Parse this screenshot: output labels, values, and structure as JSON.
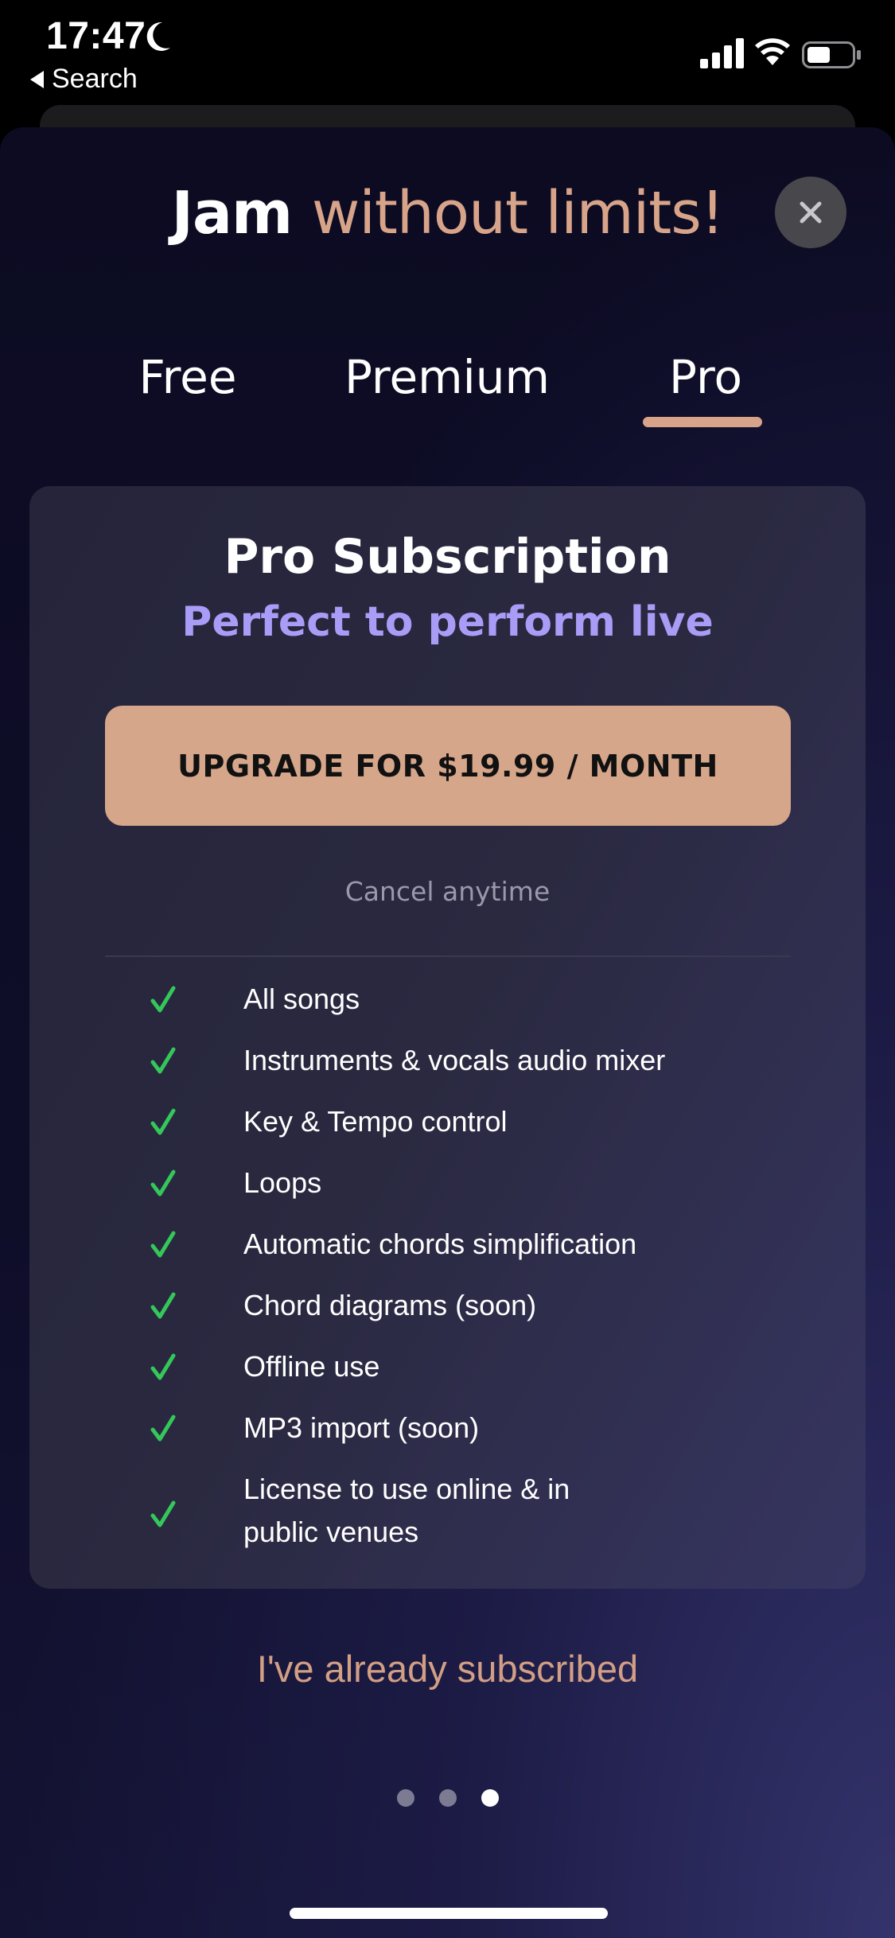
{
  "status_bar": {
    "time": "17:47",
    "focus_icon": "moon-icon",
    "back_label": "Search",
    "signal_icon": "cellular-signal-icon",
    "wifi_icon": "wifi-icon",
    "battery_icon": "battery-icon",
    "battery_level": 0.5
  },
  "header": {
    "title_part1": "Jam",
    "title_part2": "without limits!",
    "close_icon": "close-icon"
  },
  "tabs": [
    {
      "label": "Free",
      "active": false
    },
    {
      "label": "Premium",
      "active": false
    },
    {
      "label": "Pro",
      "active": true
    }
  ],
  "plan": {
    "title": "Pro Subscription",
    "subtitle": "Perfect to perform live",
    "cta_label": "UPGRADE FOR $19.99 / MONTH",
    "note": "Cancel anytime",
    "features": [
      {
        "icon": "check-icon",
        "label": "All songs"
      },
      {
        "icon": "check-icon",
        "label": "Instruments & vocals audio mixer"
      },
      {
        "icon": "check-icon",
        "label": "Key & Tempo control"
      },
      {
        "icon": "check-icon",
        "label": "Loops"
      },
      {
        "icon": "check-icon",
        "label": "Automatic chords simplification"
      },
      {
        "icon": "check-icon",
        "label": "Chord diagrams (soon)"
      },
      {
        "icon": "check-icon",
        "label": "Offline use"
      },
      {
        "icon": "check-icon",
        "label": "MP3 import (soon)"
      },
      {
        "icon": "check-icon",
        "label_line1": "License to use online & in",
        "label_line2": "public venues"
      }
    ]
  },
  "footer": {
    "restore_label": "I've already subscribed",
    "page_count": 3,
    "current_page": 3
  },
  "colors": {
    "accent": "#d8a489",
    "subtitle": "#a99cf7",
    "check": "#34c759",
    "background": "#0c0b22"
  }
}
